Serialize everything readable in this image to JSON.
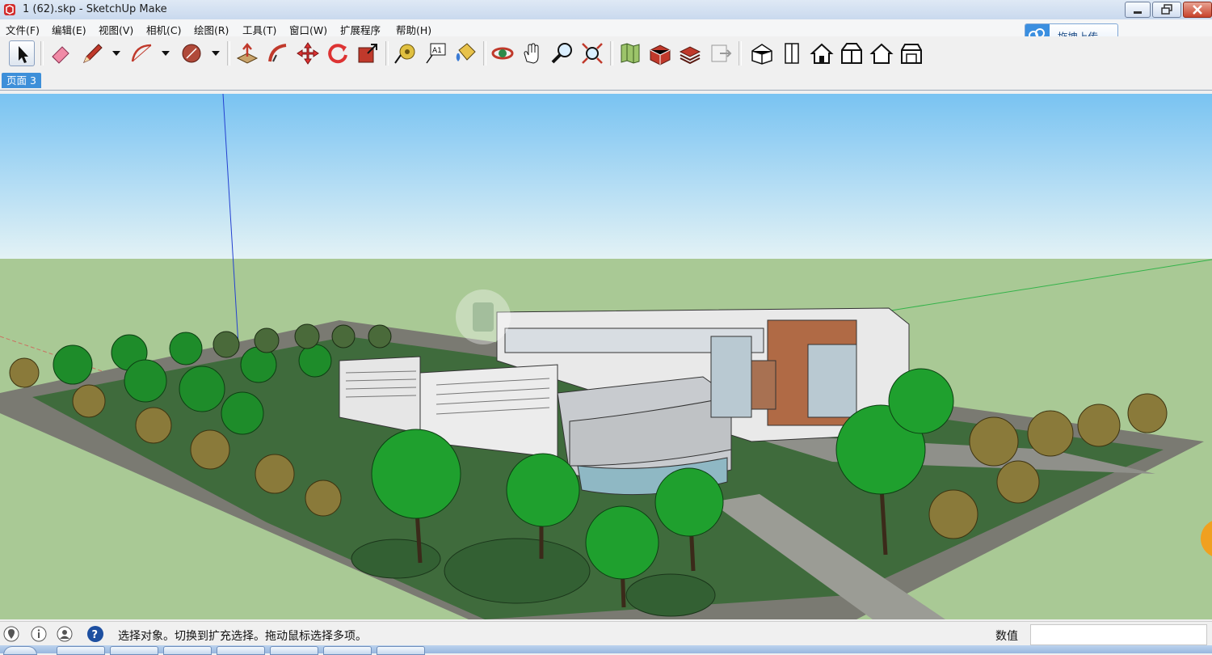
{
  "window": {
    "title": "1 (62).skp - SketchUp Make"
  },
  "menu": {
    "items": [
      "文件(F)",
      "编辑(E)",
      "视图(V)",
      "相机(C)",
      "绘图(R)",
      "工具(T)",
      "窗口(W)",
      "扩展程序",
      "帮助(H)"
    ]
  },
  "upload": {
    "label": "拖拽上传"
  },
  "tabs": {
    "active": "页面 3"
  },
  "toolbar": {
    "tools": [
      "select-icon",
      "eraser-icon",
      "pencil-icon",
      "arc-icon",
      "shape-icon",
      "push-pull-icon",
      "follow-me-icon",
      "move-icon",
      "rotate-icon",
      "scale-icon",
      "tape-measure-icon",
      "text-icon",
      "paint-bucket-icon",
      "orbit-icon",
      "pan-icon",
      "zoom-icon",
      "zoom-extents-icon",
      "map-icon",
      "3d-warehouse-icon",
      "extension-warehouse-icon",
      "layout-icon",
      "iso-view-icon",
      "top-view-icon",
      "front-view-icon",
      "right-view-icon",
      "back-view-icon",
      "left-view-icon"
    ]
  },
  "status": {
    "text": "选择对象。切换到扩充选择。拖动鼠标选择多项。",
    "measurements_label": "数值",
    "measurements_value": ""
  },
  "viewport": {
    "sky_top": "#79c3f2",
    "sky_bottom": "#e3f2f5",
    "ground": "#a9c995"
  }
}
